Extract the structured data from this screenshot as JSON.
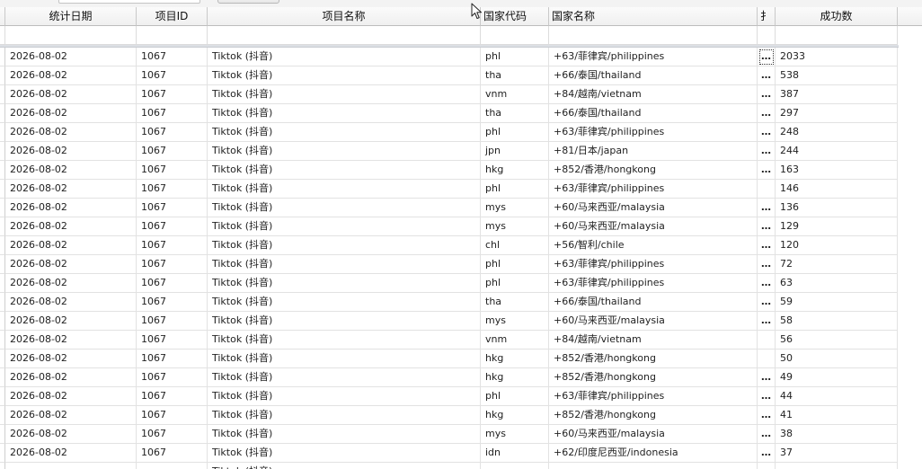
{
  "grid": {
    "columns": [
      "统计日期",
      "项目ID",
      "项目名称",
      "国家代码",
      "国家名称",
      "扌",
      "成功数"
    ],
    "rows": [
      {
        "date": "2026-08-02",
        "pid": "1067",
        "pname": "Tiktok (抖音)",
        "code": "phl",
        "country": "+63/菲律宾/philippines",
        "more": "…",
        "count": "2033"
      },
      {
        "date": "2026-08-02",
        "pid": "1067",
        "pname": "Tiktok (抖音)",
        "code": "tha",
        "country": "+66/泰国/thailand",
        "more": "…",
        "count": "538"
      },
      {
        "date": "2026-08-02",
        "pid": "1067",
        "pname": "Tiktok (抖音)",
        "code": "vnm",
        "country": "+84/越南/vietnam",
        "more": "…",
        "count": "387"
      },
      {
        "date": "2026-08-02",
        "pid": "1067",
        "pname": "Tiktok (抖音)",
        "code": "tha",
        "country": "+66/泰国/thailand",
        "more": "…",
        "count": "297"
      },
      {
        "date": "2026-08-02",
        "pid": "1067",
        "pname": "Tiktok (抖音)",
        "code": "phl",
        "country": "+63/菲律宾/philippines",
        "more": "…",
        "count": "248"
      },
      {
        "date": "2026-08-02",
        "pid": "1067",
        "pname": "Tiktok (抖音)",
        "code": "jpn",
        "country": "+81/日本/japan",
        "more": "…",
        "count": "244"
      },
      {
        "date": "2026-08-02",
        "pid": "1067",
        "pname": "Tiktok (抖音)",
        "code": "hkg",
        "country": "+852/香港/hongkong",
        "more": "…",
        "count": "163"
      },
      {
        "date": "2026-08-02",
        "pid": "1067",
        "pname": "Tiktok (抖音)",
        "code": "phl",
        "country": "+63/菲律宾/philippines",
        "more": "",
        "count": "146"
      },
      {
        "date": "2026-08-02",
        "pid": "1067",
        "pname": "Tiktok (抖音)",
        "code": "mys",
        "country": "+60/马来西亚/malaysia",
        "more": "…",
        "count": "136"
      },
      {
        "date": "2026-08-02",
        "pid": "1067",
        "pname": "Tiktok (抖音)",
        "code": "mys",
        "country": "+60/马来西亚/malaysia",
        "more": "…",
        "count": "129"
      },
      {
        "date": "2026-08-02",
        "pid": "1067",
        "pname": "Tiktok (抖音)",
        "code": "chl",
        "country": "+56/智利/chile",
        "more": "…",
        "count": "120"
      },
      {
        "date": "2026-08-02",
        "pid": "1067",
        "pname": "Tiktok (抖音)",
        "code": "phl",
        "country": "+63/菲律宾/philippines",
        "more": "…",
        "count": "72"
      },
      {
        "date": "2026-08-02",
        "pid": "1067",
        "pname": "Tiktok (抖音)",
        "code": "phl",
        "country": "+63/菲律宾/philippines",
        "more": "…",
        "count": "63"
      },
      {
        "date": "2026-08-02",
        "pid": "1067",
        "pname": "Tiktok (抖音)",
        "code": "tha",
        "country": "+66/泰国/thailand",
        "more": "…",
        "count": "59"
      },
      {
        "date": "2026-08-02",
        "pid": "1067",
        "pname": "Tiktok (抖音)",
        "code": "mys",
        "country": "+60/马来西亚/malaysia",
        "more": "…",
        "count": "58"
      },
      {
        "date": "2026-08-02",
        "pid": "1067",
        "pname": "Tiktok (抖音)",
        "code": "vnm",
        "country": "+84/越南/vietnam",
        "more": "",
        "count": "56"
      },
      {
        "date": "2026-08-02",
        "pid": "1067",
        "pname": "Tiktok (抖音)",
        "code": "hkg",
        "country": "+852/香港/hongkong",
        "more": "",
        "count": "50"
      },
      {
        "date": "2026-08-02",
        "pid": "1067",
        "pname": "Tiktok (抖音)",
        "code": "hkg",
        "country": "+852/香港/hongkong",
        "more": "…",
        "count": "49"
      },
      {
        "date": "2026-08-02",
        "pid": "1067",
        "pname": "Tiktok (抖音)",
        "code": "phl",
        "country": "+63/菲律宾/philippines",
        "more": "…",
        "count": "44"
      },
      {
        "date": "2026-08-02",
        "pid": "1067",
        "pname": "Tiktok (抖音)",
        "code": "hkg",
        "country": "+852/香港/hongkong",
        "more": "…",
        "count": "41"
      },
      {
        "date": "2026-08-02",
        "pid": "1067",
        "pname": "Tiktok (抖音)",
        "code": "mys",
        "country": "+60/马来西亚/malaysia",
        "more": "…",
        "count": "38"
      },
      {
        "date": "2026-08-02",
        "pid": "1067",
        "pname": "Tiktok (抖音)",
        "code": "idn",
        "country": "+62/印度尼西亚/indonesia",
        "more": "…",
        "count": "37"
      },
      {
        "date": "",
        "pid": "",
        "pname": "Tiktok (抖音)",
        "code": "",
        "country": "",
        "more": "",
        "count": ""
      }
    ]
  },
  "icons": {
    "cursor": "mouse-pointer-icon"
  }
}
